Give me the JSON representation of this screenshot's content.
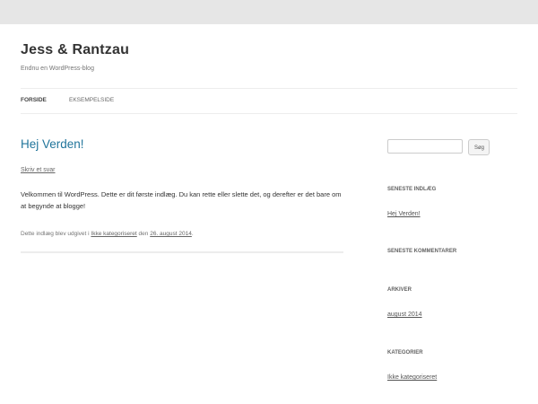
{
  "header": {
    "site_title": "Jess & Rantzau",
    "site_description": "Endnu en WordPress-blog"
  },
  "nav": {
    "items": [
      {
        "label": "FORSIDE",
        "active": true
      },
      {
        "label": "EKSEMPELSIDE",
        "active": false
      }
    ]
  },
  "post": {
    "title": "Hej Verden!",
    "reply_link": "Skriv et svar",
    "content": "Velkommen til WordPress. Dette er dit første indlæg. Du kan rette eller slette det, og derefter er det bare om at begynde at blogge!",
    "meta_prefix": "Dette indlæg blev udgivet i",
    "meta_category": "Ikke kategoriseret",
    "meta_mid": "den",
    "meta_date": "26. august 2014",
    "meta_end": "."
  },
  "sidebar": {
    "search": {
      "placeholder": "",
      "button_label": "Søg"
    },
    "recent_posts": {
      "title": "SENESTE INDLÆG",
      "items": [
        "Hej Verden!"
      ]
    },
    "recent_comments": {
      "title": "SENESTE KOMMENTARER"
    },
    "archives": {
      "title": "ARKIVER",
      "items": [
        "august 2014"
      ]
    },
    "categories": {
      "title": "KATEGORIER",
      "items": [
        "Ikke kategoriseret"
      ]
    }
  },
  "colors": {
    "background": "#e6e6e6",
    "page": "#ffffff",
    "link_accent": "#21759b"
  }
}
